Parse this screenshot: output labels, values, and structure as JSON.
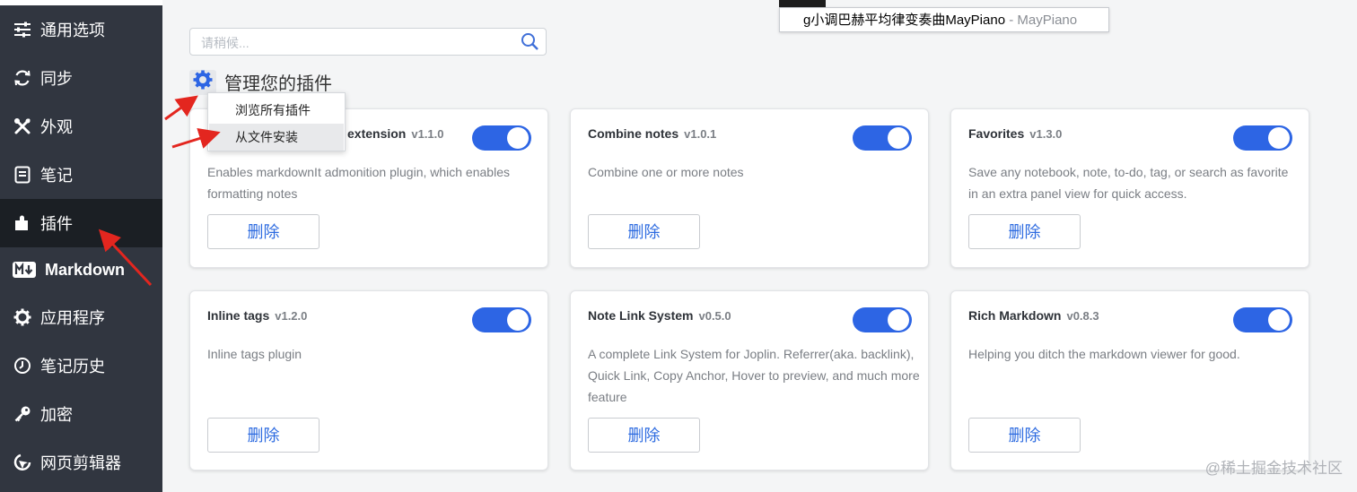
{
  "sidebar": {
    "items": [
      {
        "label": "通用选项",
        "icon": "sliders-icon"
      },
      {
        "label": "同步",
        "icon": "sync-icon"
      },
      {
        "label": "外观",
        "icon": "tools-icon"
      },
      {
        "label": "笔记",
        "icon": "note-icon"
      },
      {
        "label": "插件",
        "icon": "puzzle-icon",
        "active": true
      },
      {
        "label": "Markdown",
        "icon": "markdown-icon"
      },
      {
        "label": "应用程序",
        "icon": "gear-icon"
      },
      {
        "label": "笔记历史",
        "icon": "history-icon"
      },
      {
        "label": "加密",
        "icon": "key-icon"
      },
      {
        "label": "网页剪辑器",
        "icon": "clipper-icon"
      }
    ]
  },
  "search": {
    "placeholder": "请稍候..."
  },
  "manage": {
    "title": "管理您的插件"
  },
  "menu": {
    "items": [
      {
        "label": "浏览所有插件"
      },
      {
        "label": "从文件安装"
      }
    ]
  },
  "tooltip": {
    "title": "g小调巴赫平均律变奏曲MayPiano",
    "separator": " - ",
    "site": "MayPiano"
  },
  "plugins": [
    {
      "name": "extension",
      "version": "v1.1.0",
      "description": "Enables markdownIt admonition plugin, which enables formatting notes",
      "enabled": true,
      "delete_label": "删除"
    },
    {
      "name": "Combine notes",
      "version": "v1.0.1",
      "description": "Combine one or more notes",
      "enabled": true,
      "delete_label": "删除"
    },
    {
      "name": "Favorites",
      "version": "v1.3.0",
      "description": "Save any notebook, note, to-do, tag, or search as favorite in an extra panel view for quick access.",
      "enabled": true,
      "delete_label": "删除"
    },
    {
      "name": "Inline tags",
      "version": "v1.2.0",
      "description": "Inline tags plugin",
      "enabled": true,
      "delete_label": "删除"
    },
    {
      "name": "Note Link System",
      "version": "v0.5.0",
      "description": "A complete Link System for Joplin. Referrer(aka. backlink), Quick Link, Copy Anchor, Hover to preview, and much more feature",
      "enabled": true,
      "delete_label": "删除"
    },
    {
      "name": "Rich Markdown",
      "version": "v0.8.3",
      "description": "Helping you ditch the markdown viewer for good.",
      "enabled": true,
      "delete_label": "删除"
    }
  ],
  "watermark": "@稀土掘金技术社区",
  "colors": {
    "sidebar_bg": "#313640",
    "sidebar_active": "#1b1f24",
    "accent": "#2d65e4",
    "annotation_arrow": "#e3261f"
  }
}
